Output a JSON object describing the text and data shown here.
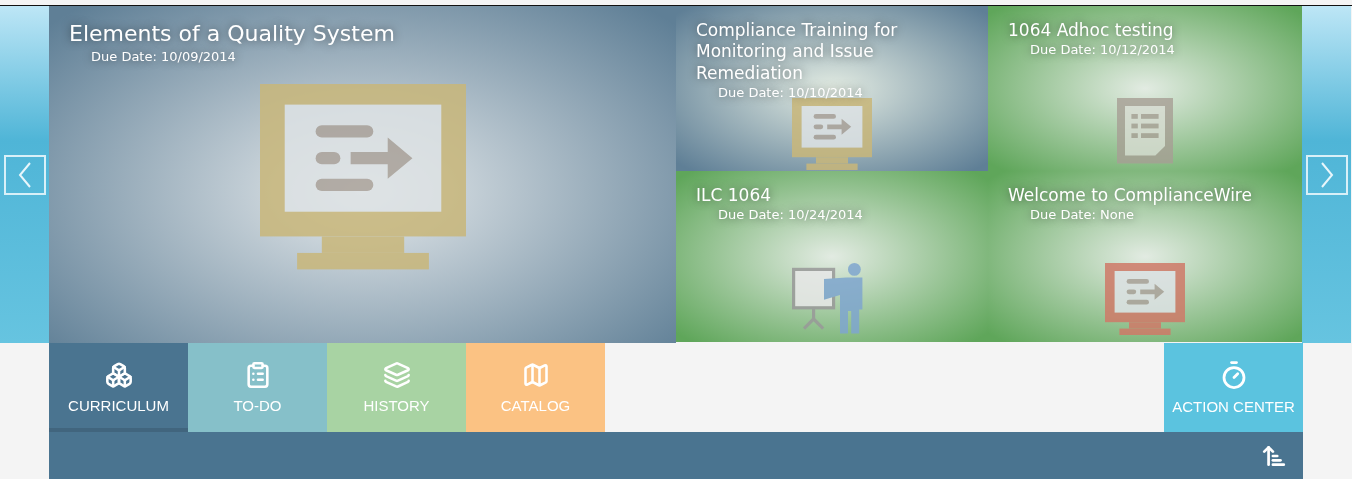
{
  "featured": {
    "title": "Elements of a Quality System",
    "due": "Due Date: 10/09/2014",
    "color": "#5f7f96",
    "icon": {
      "kind": "monitor",
      "color": "#c9b77a"
    }
  },
  "tiles": [
    {
      "title": "Compliance Training for Monitoring and Issue Remediation",
      "due": "Due Date: 10/10/2014",
      "color": "#5f7f96",
      "icon": {
        "kind": "monitor",
        "color": "#c9b77a"
      }
    },
    {
      "title": "1064 Adhoc testing",
      "due": "Due Date: 10/12/2014",
      "color": "#5fa65a",
      "icon": {
        "kind": "document",
        "color": "#a79f95"
      }
    },
    {
      "title": "ILC 1064",
      "due": "Due Date: 10/24/2014",
      "color": "#5fa65a",
      "icon": {
        "kind": "presenter",
        "color": "#7fa6cf"
      }
    },
    {
      "title": "Welcome to ComplianceWire",
      "due": "Due Date: None",
      "color": "#5fa65a",
      "icon": {
        "kind": "monitor",
        "color": "#cf7a68"
      }
    }
  ],
  "tabs": [
    {
      "label": "CURRICULUM",
      "selected": true,
      "color": "#4a7490",
      "kind": "curriculum"
    },
    {
      "label": "TO-DO",
      "selected": false,
      "color": "#86c0c9",
      "kind": "todo"
    },
    {
      "label": "HISTORY",
      "selected": false,
      "color": "#a8d3a3",
      "kind": "history"
    },
    {
      "label": "CATALOG",
      "selected": false,
      "color": "#fbc283",
      "kind": "catalog"
    }
  ],
  "action_center": {
    "label": "ACTION CENTER"
  }
}
